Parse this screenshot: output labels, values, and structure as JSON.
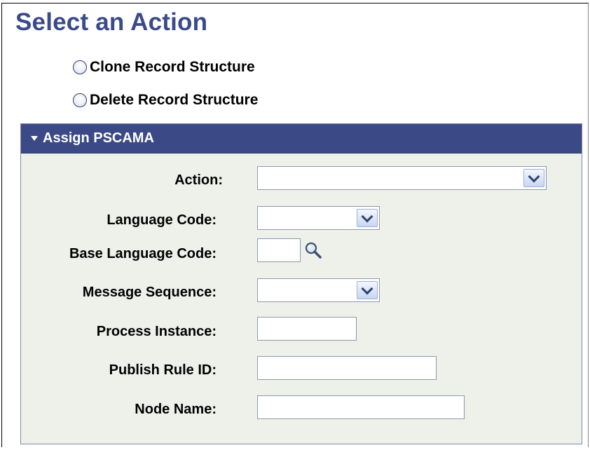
{
  "page": {
    "title": "Select an Action"
  },
  "actions": [
    {
      "label": "Clone Record Structure",
      "selected": false
    },
    {
      "label": "Delete Record Structure",
      "selected": false
    }
  ],
  "panel": {
    "title": "Assign PSCAMA",
    "fields": {
      "action": {
        "label": "Action:",
        "value": ""
      },
      "language_code": {
        "label": "Language Code:",
        "value": ""
      },
      "base_language_code": {
        "label": "Base Language Code:",
        "value": ""
      },
      "message_sequence": {
        "label": "Message Sequence:",
        "value": ""
      },
      "process_instance": {
        "label": "Process Instance:",
        "value": ""
      },
      "publish_rule_id": {
        "label": "Publish Rule ID:",
        "value": ""
      },
      "node_name": {
        "label": "Node Name:",
        "value": ""
      }
    }
  },
  "icons": {
    "expand": "triangle-down-icon",
    "lookup": "magnifier-icon",
    "dropdown": "chevron-down-icon"
  },
  "colors": {
    "title": "#3a4a8a",
    "panel_header": "#3b4a86",
    "panel_body": "#eef1ea"
  }
}
